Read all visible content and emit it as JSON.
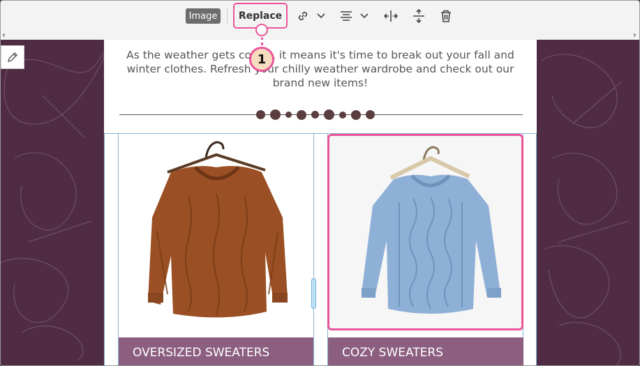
{
  "toolbar": {
    "image_tag": "Image",
    "replace_label": "Replace",
    "icons": [
      "link-icon",
      "chevron-down-icon",
      "align-center-icon",
      "chevron-down-icon",
      "resize-width-icon",
      "resize-height-icon",
      "trash-icon"
    ]
  },
  "content": {
    "intro_text": "As the weather gets colder, it means it's time to break out your fall and winter clothes. Refresh your chilly weather wardrobe and check out our brand new items!"
  },
  "products": [
    {
      "caption": "OVERSIZED SWEATERS",
      "color": "#9a4f24"
    },
    {
      "caption": "COZY SWEATERS",
      "color": "#8fb0d6"
    }
  ],
  "callout": {
    "number": "1"
  },
  "colors": {
    "accent": "#e9559b",
    "caption_bg": "#8c5f80",
    "background": "#4f2c44"
  }
}
